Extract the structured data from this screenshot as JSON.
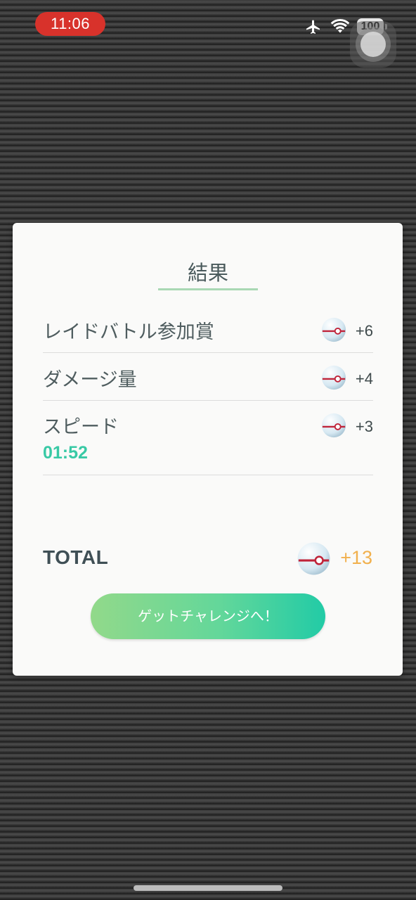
{
  "status_bar": {
    "time": "11:06",
    "battery": "100",
    "icons": [
      "airplane-icon",
      "wifi-icon",
      "battery-icon"
    ]
  },
  "results": {
    "title": "結果",
    "rows": [
      {
        "label": "レイドバトル参加賞",
        "value": "+6",
        "icon": "premier-ball-icon"
      },
      {
        "label": "ダメージ量",
        "value": "+4",
        "icon": "premier-ball-icon"
      },
      {
        "label": "スピード",
        "value": "+3",
        "icon": "premier-ball-icon",
        "sub_value": "01:52"
      }
    ],
    "total_label": "TOTAL",
    "total_value": "+13",
    "button_label": "ゲットチャレンジへ！"
  },
  "colors": {
    "accent_green": "#38c9a5",
    "total_orange": "#f1b04d",
    "time_pill_red": "#d8322b"
  }
}
